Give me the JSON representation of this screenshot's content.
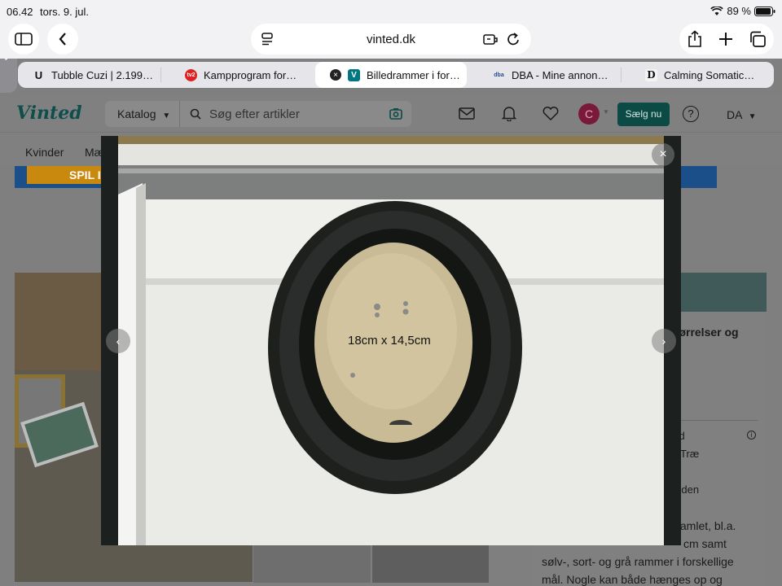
{
  "status": {
    "time": "06.42",
    "date": "tors. 9. jul.",
    "battery": "89 %"
  },
  "browser": {
    "host": "vinted.dk",
    "tabs": [
      {
        "label": "Tubble Cuzi | 2.199…",
        "icon": "U"
      },
      {
        "label": "Kampprogram for…",
        "icon": "tv2"
      },
      {
        "label": "Billedrammer i for…",
        "icon": "V"
      },
      {
        "label": "DBA - Mine annon…",
        "icon": "dba"
      },
      {
        "label": "Calming Somatic…",
        "icon": "D"
      }
    ]
  },
  "vinted": {
    "logo": "Vinted",
    "catalog": "Katalog",
    "search_placeholder": "Søg efter artikler",
    "avatar_letter": "C",
    "sell_label": "Sælg nu",
    "help": "?",
    "lang": "DA",
    "nav": [
      "Kvinder",
      "Mæ"
    ],
    "banner_text": "SPIL I"
  },
  "panel": {
    "title_fragment": "størrelser og",
    "row1": "god",
    "row2": "Træ",
    "row3": "siden",
    "desc1": "s samlet, bl.a.",
    "desc2": "cm samt",
    "desc3": "sølv-, sort- og grå rammer i forskellige",
    "desc4": "mål. Nogle kan både hænges op og"
  },
  "lightbox": {
    "caption": "18cm x 14,5cm",
    "close": "×",
    "prev": "‹",
    "next": "›"
  },
  "colors": {
    "brand": "#007782",
    "sell": "#0c4a46",
    "frame": "#1e201e"
  }
}
